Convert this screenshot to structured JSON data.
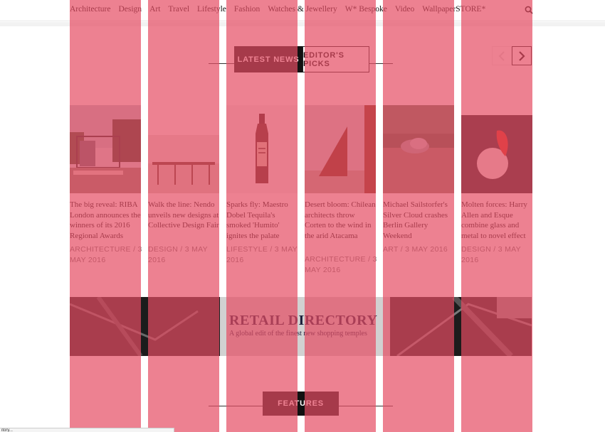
{
  "nav": {
    "items": [
      "Architecture",
      "Design",
      "Art",
      "Travel",
      "Lifestyle",
      "Fashion",
      "Watches & Jewellery",
      "W* Bespoke",
      "Video",
      "WallpaperSTORE*"
    ],
    "search_icon": "search-icon"
  },
  "tabs": {
    "active": "LATEST NEWS",
    "inactive": "EDITOR'S PICKS"
  },
  "carousel": {
    "prev_icon": "chevron-left-icon",
    "next_icon": "chevron-right-icon"
  },
  "cards": [
    {
      "title": "The big reveal: RIBA London announces the winners of its 2016 Regional Awards",
      "meta": "ARCHITECTURE / 3 MAY 2016"
    },
    {
      "title": "Walk the line: Nendo unveils new designs at Collective Design Fair",
      "meta": "DESIGN / 3 MAY 2016"
    },
    {
      "title": "Sparks fly: Maestro Dobel Tequila's smoked 'Humito' ignites the palate",
      "meta": "LIFESTYLE / 3 MAY 2016"
    },
    {
      "title": "Desert bloom: Chilean architects throw Corten to the wind in the arid Atacama",
      "meta": "ARCHITECTURE / 3 MAY 2016"
    },
    {
      "title": "Michael Sailstorfer's Silver Cloud crashes Berlin Gallery Weekend",
      "meta": "ART / 3 MAY 2016"
    },
    {
      "title": "Molten forces: Harry Allen and Esque combine glass and metal to novel effect",
      "meta": "DESIGN / 3 MAY 2016"
    }
  ],
  "banner": {
    "title": "RETAIL DIRECTORY",
    "subtitle": "A global edit of the finest new shopping temples"
  },
  "features": {
    "label": "FEATURES"
  },
  "status": {
    "text": "itory..."
  },
  "colors": {
    "overlay": "#e54b62",
    "banner_text": "#1b1f3b"
  }
}
